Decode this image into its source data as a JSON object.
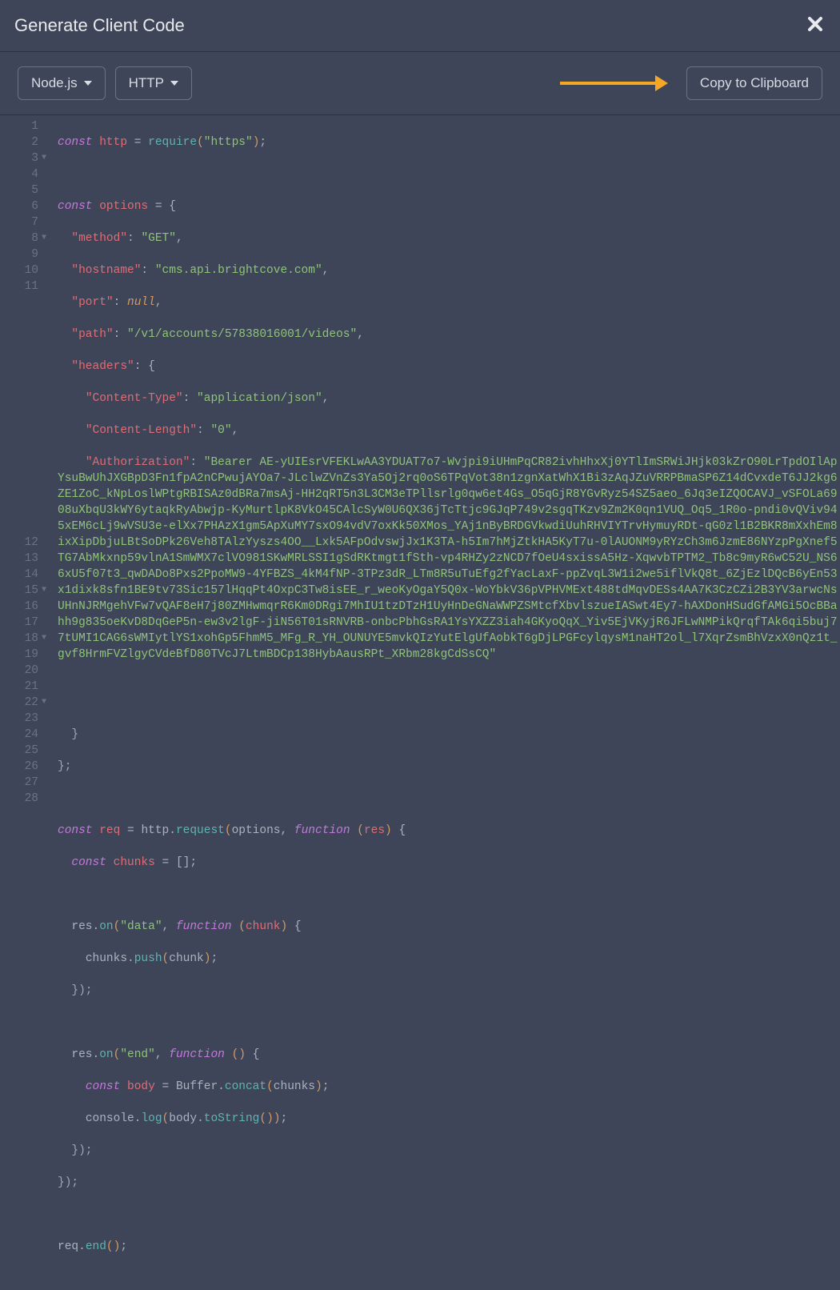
{
  "modal": {
    "title": "Generate Client Code",
    "close_label": "✕"
  },
  "toolbar": {
    "language_label": "Node.js",
    "variant_label": "HTTP",
    "copy_label": "Copy to Clipboard"
  },
  "code": {
    "method": "GET",
    "hostname": "cms.api.brightcove.com",
    "port": "null",
    "path": "/v1/accounts/57838016001/videos",
    "content_type": "application/json",
    "content_length": "0",
    "bearer_prefix": "Bearer ",
    "token": "AE-yUIEsrVFEKLwAA3YDUAT7o7-Wvjpi9iUHmPqCR82ivhHhxXj0YTlImSRWiJHjk03kZrO90LrTpdOIlApYsuBwUhJXGBpD3Fn1fpA2nCPwujAYOa7-JLclwZVnZs3Ya5Oj2rq0oS6TPqVot38n1zgnXatWhX1Bi3zAqJZuVRRPBmaSP6Z14dCvxdeT6JJ2kg6ZE1ZoC_kNpLoslWPtgRBISAz0dBRa7msAj-HH2qRT5n3L3CM3eTPllsrlg0qw6et4Gs_O5qGjR8YGvRyz54SZ5aeo_6Jq3eIZQOCAVJ_vSFOLa6908uXbqU3kWY6ytaqkRyAbwjp-KyMurtlpK8VkO45CAlcSyW0U6QX36jTcTtjc9GJqP749v2sgqTKzv9Zm2K0qn1VUQ_Oq5_1R0o-pndi0vQViv945xEM6cLj9wVSU3e-elXx7PHAzX1gm5ApXuMY7sxO94vdV7oxKk50XMos_YAj1nByBRDGVkwdiUuhRHVIYTrvHymuyRDt-qG0zl1B2BKR8mXxhEm8ixXipDbjuLBtSoDPk26Veh8TAlzYyszs4OO__Lxk5AFpOdvswjJx1K3TA-h5Im7hMjZtkHA5KyT7u-0lAUONM9yRYzCh3m6JzmE86NYzpPgXnef5TG7AbMkxnp59vlnA1SmWMX7clVO981SKwMRLSSI1gSdRKtmgt1fSth-vp4RHZy2zNCD7fOeU4sxissA5Hz-XqwvbTPTM2_Tb8c9myR6wC52U_NS66xU5f07t3_qwDADo8Pxs2PpoMW9-4YFBZS_4kM4fNP-3TPz3dR_LTm8R5uTuEfg2fYacLaxF-ppZvqL3W1i2we5iflVkQ8t_6ZjEzlDQcB6yEn53x1dixk8sfn1BE9tv73Sic157lHqqPt4OxpC3Tw8isEE_r_weoKyOgaY5Q0x-WoYbkV36pVPHVMExt488tdMqvDESs4AA7K3CzCZi2B3YV3arwcNsUHnNJRMgehVFw7vQAF8eH7j80ZMHwmqrR6Km0DRgi7MhIU1tzDTzH1UyHnDeGNaWWPZSMtcfXbvlszueIASwt4Ey7-hAXDonHSudGfAMGi5OcBBahh9g835oeKvD8DqGeP5n-ew3v2lgF-jiN56T01sRNVRB-onbcPbhGsRA1YsYXZZ3iah4GKyoQqX_Yiv5EjVKyjR6JFLwNMPikQrqfTAk6qi5buj77tUMI1CAG6sWMIytlYS1xohGp5FhmM5_MFg_R_YH_OUNUYE5mvkQIzYutElgUfAobkT6gDjLPGFcylqysM1naHT2ol_l7XqrZsmBhVzxX0nQz1t_gvf8HrmFVZlgyCVdeBfD80TVcJ7LtmBDCp138HybAausRPt_XRbm28kgCdSsCQ"
  },
  "lines": {
    "l1_const": "const",
    "l1_http": "http",
    "l1_eq": " = ",
    "l1_require": "require",
    "l1_paren_o": "(",
    "l1_str": "\"https\"",
    "l1_paren_c": ")",
    "l1_semi": ";",
    "l3_const": "const",
    "l3_options": "options",
    "l3_eq": " = ",
    "l3_brace": "{",
    "l4_key": "\"method\"",
    "l4_colon": ": ",
    "l4_val": "\"GET\"",
    "l4_comma": ",",
    "l5_key": "\"hostname\"",
    "l5_colon": ": ",
    "l5_val": "\"cms.api.brightcove.com\"",
    "l5_comma": ",",
    "l6_key": "\"port\"",
    "l6_colon": ": ",
    "l6_val": "null",
    "l6_comma": ",",
    "l7_key": "\"path\"",
    "l7_colon": ": ",
    "l7_val": "\"/v1/accounts/57838016001/videos\"",
    "l7_comma": ",",
    "l8_key": "\"headers\"",
    "l8_colon": ": ",
    "l8_brace": "{",
    "l9_key": "\"Content-Type\"",
    "l9_colon": ": ",
    "l9_val": "\"application/json\"",
    "l9_comma": ",",
    "l10_key": "\"Content-Length\"",
    "l10_colon": ": ",
    "l10_val": "\"0\"",
    "l10_comma": ",",
    "l11_key": "\"Authorization\"",
    "l11_colon": ": ",
    "l12": "  }",
    "l13": "};",
    "l15_const": "const",
    "l15_req": "req",
    "l15_eq": " = ",
    "l15_http": "http",
    "l15_dot": ".",
    "l15_request": "request",
    "l15_po": "(",
    "l15_opts": "options",
    "l15_comma": ", ",
    "l15_function": "function",
    "l15_po2": " (",
    "l15_res": "res",
    "l15_pc": ") ",
    "l15_brace": "{",
    "l16_const": "const",
    "l16_chunks": "chunks",
    "l16_eq": " = ",
    "l16_arr": "[]",
    "l16_semi": ";",
    "l18_res": "res",
    "l18_dot": ".",
    "l18_on": "on",
    "l18_po": "(",
    "l18_str": "\"data\"",
    "l18_comma": ", ",
    "l18_function": "function",
    "l18_po2": " (",
    "l18_chunk": "chunk",
    "l18_pc": ") ",
    "l18_brace": "{",
    "l19_chunks": "chunks",
    "l19_dot": ".",
    "l19_push": "push",
    "l19_po": "(",
    "l19_chunk": "chunk",
    "l19_pc": ")",
    "l19_semi": ";",
    "l20": "  });",
    "l22_res": "res",
    "l22_dot": ".",
    "l22_on": "on",
    "l22_po": "(",
    "l22_str": "\"end\"",
    "l22_comma": ", ",
    "l22_function": "function",
    "l22_po2": " ()",
    "l22_brace": " {",
    "l23_const": "const",
    "l23_body": "body",
    "l23_eq": " = ",
    "l23_buffer": "Buffer",
    "l23_dot": ".",
    "l23_concat": "concat",
    "l23_po": "(",
    "l23_chunks": "chunks",
    "l23_pc": ")",
    "l23_semi": ";",
    "l24_console": "console",
    "l24_dot": ".",
    "l24_log": "log",
    "l24_po": "(",
    "l24_body": "body",
    "l24_dot2": ".",
    "l24_tostring": "toString",
    "l24_pp": "()",
    "l24_pc": ")",
    "l24_semi": ";",
    "l25": "  });",
    "l26": "});",
    "l28_req": "req",
    "l28_dot": ".",
    "l28_end": "end",
    "l28_pp": "()",
    "l28_semi": ";"
  },
  "gutter": [
    "1",
    "2",
    "3",
    "4",
    "5",
    "6",
    "7",
    "8",
    "9",
    "10",
    "11",
    "12",
    "13",
    "14",
    "15",
    "16",
    "17",
    "18",
    "19",
    "20",
    "21",
    "22",
    "23",
    "24",
    "25",
    "26",
    "27",
    "28"
  ]
}
